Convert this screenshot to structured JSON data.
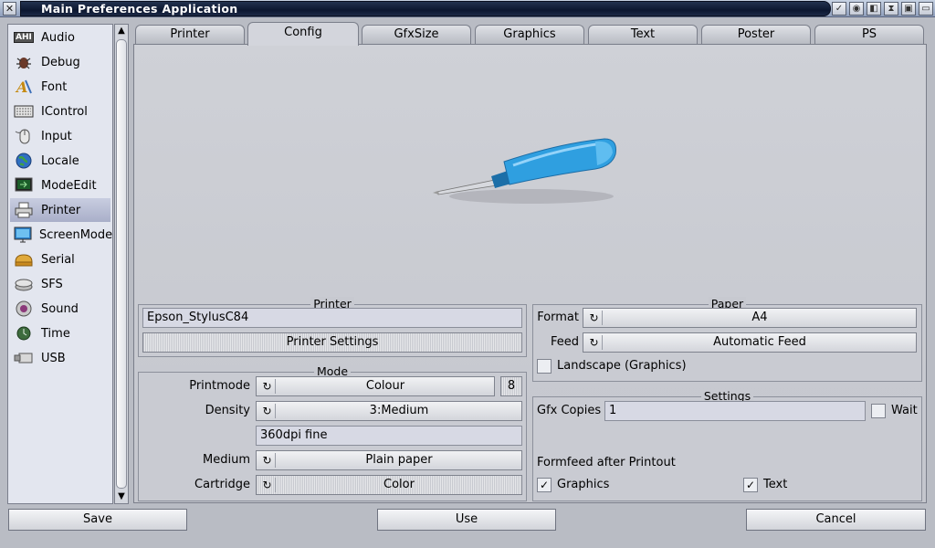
{
  "window": {
    "title": "Main Preferences Application",
    "close_glyph": "✕",
    "buttons": [
      "✓",
      "◉",
      "◧",
      "⧗",
      "▣",
      "▭"
    ]
  },
  "sidebar": {
    "items": [
      {
        "label": "Audio",
        "icon": "ahi-icon"
      },
      {
        "label": "Debug",
        "icon": "bug-icon"
      },
      {
        "label": "Font",
        "icon": "font-icon"
      },
      {
        "label": "IControl",
        "icon": "keyboard-icon"
      },
      {
        "label": "Input",
        "icon": "mouse-icon"
      },
      {
        "label": "Locale",
        "icon": "globe-icon"
      },
      {
        "label": "ModeEdit",
        "icon": "monitor-icon"
      },
      {
        "label": "Printer",
        "icon": "printer-icon",
        "selected": true
      },
      {
        "label": "ScreenMode",
        "icon": "screen-icon"
      },
      {
        "label": "Serial",
        "icon": "serial-icon"
      },
      {
        "label": "SFS",
        "icon": "disk-icon"
      },
      {
        "label": "Sound",
        "icon": "speaker-icon"
      },
      {
        "label": "Time",
        "icon": "clock-icon"
      },
      {
        "label": "USB",
        "icon": "usb-icon"
      }
    ],
    "ahi_text": "AHI",
    "scroll_up": "▲",
    "scroll_down": "▼"
  },
  "tabs": [
    {
      "label": "Printer"
    },
    {
      "label": "Config",
      "active": true
    },
    {
      "label": "GfxSize"
    },
    {
      "label": "Graphics"
    },
    {
      "label": "Text"
    },
    {
      "label": "Poster"
    },
    {
      "label": "PS"
    }
  ],
  "printer_group": {
    "title": "Printer",
    "printer_name": "Epson_StylusC84",
    "settings_button": "Printer Settings"
  },
  "mode_group": {
    "title": "Mode",
    "printmode_label": "Printmode",
    "printmode_value": "Colour",
    "printmode_extra": "8",
    "density_label": "Density",
    "density_value": "3:Medium",
    "resolution_value": "360dpi fine",
    "medium_label": "Medium",
    "medium_value": "Plain paper",
    "cartridge_label": "Cartridge",
    "cartridge_value": "Color"
  },
  "paper_group": {
    "title": "Paper",
    "format_label": "Format",
    "format_value": "A4",
    "feed_label": "Feed",
    "feed_value": "Automatic Feed",
    "landscape_label": "Landscape (Graphics)",
    "landscape_checked": false
  },
  "settings_group": {
    "title": "Settings",
    "copies_label": "Gfx Copies",
    "copies_value": "1",
    "wait_label": "Wait",
    "wait_checked": false,
    "formfeed_label": "Formfeed after Printout",
    "graphics_label": "Graphics",
    "graphics_checked": true,
    "text_label": "Text",
    "text_checked": true
  },
  "cycle_glyph": "↻",
  "check_glyph": "✓",
  "buttons": {
    "save": "Save",
    "use": "Use",
    "cancel": "Cancel"
  },
  "colors": {
    "screwdriver_handle": "#2f9fe0",
    "selection": "#b0b6cf",
    "title_bar": "#0c1730"
  }
}
